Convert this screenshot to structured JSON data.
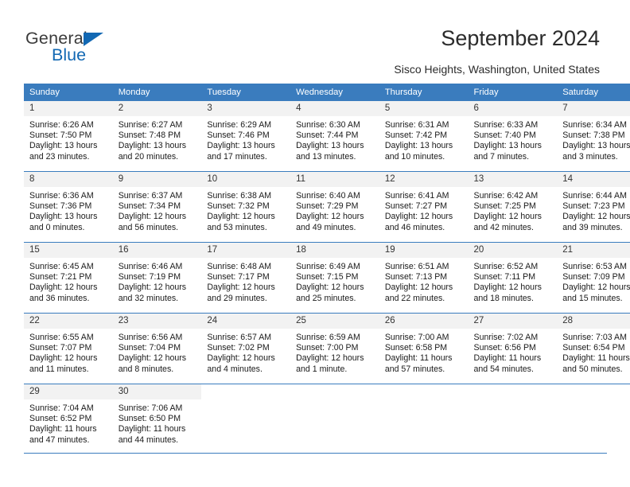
{
  "logo": {
    "text_top": "General",
    "text_bottom": "Blue",
    "icon": "triangle-logo-icon",
    "color": "#1268b3"
  },
  "header": {
    "title": "September 2024",
    "subtitle": "Sisco Heights, Washington, United States"
  },
  "theme": {
    "header_bg": "#3a7cbe",
    "daynum_bg": "#f2f2f2",
    "text": "#1a1a1a"
  },
  "weekday_headers": [
    "Sunday",
    "Monday",
    "Tuesday",
    "Wednesday",
    "Thursday",
    "Friday",
    "Saturday"
  ],
  "weeks": [
    [
      {
        "day": "1",
        "sunrise": "Sunrise: 6:26 AM",
        "sunset": "Sunset: 7:50 PM",
        "daylight1": "Daylight: 13 hours",
        "daylight2": "and 23 minutes."
      },
      {
        "day": "2",
        "sunrise": "Sunrise: 6:27 AM",
        "sunset": "Sunset: 7:48 PM",
        "daylight1": "Daylight: 13 hours",
        "daylight2": "and 20 minutes."
      },
      {
        "day": "3",
        "sunrise": "Sunrise: 6:29 AM",
        "sunset": "Sunset: 7:46 PM",
        "daylight1": "Daylight: 13 hours",
        "daylight2": "and 17 minutes."
      },
      {
        "day": "4",
        "sunrise": "Sunrise: 6:30 AM",
        "sunset": "Sunset: 7:44 PM",
        "daylight1": "Daylight: 13 hours",
        "daylight2": "and 13 minutes."
      },
      {
        "day": "5",
        "sunrise": "Sunrise: 6:31 AM",
        "sunset": "Sunset: 7:42 PM",
        "daylight1": "Daylight: 13 hours",
        "daylight2": "and 10 minutes."
      },
      {
        "day": "6",
        "sunrise": "Sunrise: 6:33 AM",
        "sunset": "Sunset: 7:40 PM",
        "daylight1": "Daylight: 13 hours",
        "daylight2": "and 7 minutes."
      },
      {
        "day": "7",
        "sunrise": "Sunrise: 6:34 AM",
        "sunset": "Sunset: 7:38 PM",
        "daylight1": "Daylight: 13 hours",
        "daylight2": "and 3 minutes."
      }
    ],
    [
      {
        "day": "8",
        "sunrise": "Sunrise: 6:36 AM",
        "sunset": "Sunset: 7:36 PM",
        "daylight1": "Daylight: 13 hours",
        "daylight2": "and 0 minutes."
      },
      {
        "day": "9",
        "sunrise": "Sunrise: 6:37 AM",
        "sunset": "Sunset: 7:34 PM",
        "daylight1": "Daylight: 12 hours",
        "daylight2": "and 56 minutes."
      },
      {
        "day": "10",
        "sunrise": "Sunrise: 6:38 AM",
        "sunset": "Sunset: 7:32 PM",
        "daylight1": "Daylight: 12 hours",
        "daylight2": "and 53 minutes."
      },
      {
        "day": "11",
        "sunrise": "Sunrise: 6:40 AM",
        "sunset": "Sunset: 7:29 PM",
        "daylight1": "Daylight: 12 hours",
        "daylight2": "and 49 minutes."
      },
      {
        "day": "12",
        "sunrise": "Sunrise: 6:41 AM",
        "sunset": "Sunset: 7:27 PM",
        "daylight1": "Daylight: 12 hours",
        "daylight2": "and 46 minutes."
      },
      {
        "day": "13",
        "sunrise": "Sunrise: 6:42 AM",
        "sunset": "Sunset: 7:25 PM",
        "daylight1": "Daylight: 12 hours",
        "daylight2": "and 42 minutes."
      },
      {
        "day": "14",
        "sunrise": "Sunrise: 6:44 AM",
        "sunset": "Sunset: 7:23 PM",
        "daylight1": "Daylight: 12 hours",
        "daylight2": "and 39 minutes."
      }
    ],
    [
      {
        "day": "15",
        "sunrise": "Sunrise: 6:45 AM",
        "sunset": "Sunset: 7:21 PM",
        "daylight1": "Daylight: 12 hours",
        "daylight2": "and 36 minutes."
      },
      {
        "day": "16",
        "sunrise": "Sunrise: 6:46 AM",
        "sunset": "Sunset: 7:19 PM",
        "daylight1": "Daylight: 12 hours",
        "daylight2": "and 32 minutes."
      },
      {
        "day": "17",
        "sunrise": "Sunrise: 6:48 AM",
        "sunset": "Sunset: 7:17 PM",
        "daylight1": "Daylight: 12 hours",
        "daylight2": "and 29 minutes."
      },
      {
        "day": "18",
        "sunrise": "Sunrise: 6:49 AM",
        "sunset": "Sunset: 7:15 PM",
        "daylight1": "Daylight: 12 hours",
        "daylight2": "and 25 minutes."
      },
      {
        "day": "19",
        "sunrise": "Sunrise: 6:51 AM",
        "sunset": "Sunset: 7:13 PM",
        "daylight1": "Daylight: 12 hours",
        "daylight2": "and 22 minutes."
      },
      {
        "day": "20",
        "sunrise": "Sunrise: 6:52 AM",
        "sunset": "Sunset: 7:11 PM",
        "daylight1": "Daylight: 12 hours",
        "daylight2": "and 18 minutes."
      },
      {
        "day": "21",
        "sunrise": "Sunrise: 6:53 AM",
        "sunset": "Sunset: 7:09 PM",
        "daylight1": "Daylight: 12 hours",
        "daylight2": "and 15 minutes."
      }
    ],
    [
      {
        "day": "22",
        "sunrise": "Sunrise: 6:55 AM",
        "sunset": "Sunset: 7:07 PM",
        "daylight1": "Daylight: 12 hours",
        "daylight2": "and 11 minutes."
      },
      {
        "day": "23",
        "sunrise": "Sunrise: 6:56 AM",
        "sunset": "Sunset: 7:04 PM",
        "daylight1": "Daylight: 12 hours",
        "daylight2": "and 8 minutes."
      },
      {
        "day": "24",
        "sunrise": "Sunrise: 6:57 AM",
        "sunset": "Sunset: 7:02 PM",
        "daylight1": "Daylight: 12 hours",
        "daylight2": "and 4 minutes."
      },
      {
        "day": "25",
        "sunrise": "Sunrise: 6:59 AM",
        "sunset": "Sunset: 7:00 PM",
        "daylight1": "Daylight: 12 hours",
        "daylight2": "and 1 minute."
      },
      {
        "day": "26",
        "sunrise": "Sunrise: 7:00 AM",
        "sunset": "Sunset: 6:58 PM",
        "daylight1": "Daylight: 11 hours",
        "daylight2": "and 57 minutes."
      },
      {
        "day": "27",
        "sunrise": "Sunrise: 7:02 AM",
        "sunset": "Sunset: 6:56 PM",
        "daylight1": "Daylight: 11 hours",
        "daylight2": "and 54 minutes."
      },
      {
        "day": "28",
        "sunrise": "Sunrise: 7:03 AM",
        "sunset": "Sunset: 6:54 PM",
        "daylight1": "Daylight: 11 hours",
        "daylight2": "and 50 minutes."
      }
    ],
    [
      {
        "day": "29",
        "sunrise": "Sunrise: 7:04 AM",
        "sunset": "Sunset: 6:52 PM",
        "daylight1": "Daylight: 11 hours",
        "daylight2": "and 47 minutes."
      },
      {
        "day": "30",
        "sunrise": "Sunrise: 7:06 AM",
        "sunset": "Sunset: 6:50 PM",
        "daylight1": "Daylight: 11 hours",
        "daylight2": "and 44 minutes."
      },
      null,
      null,
      null,
      null,
      null
    ]
  ]
}
